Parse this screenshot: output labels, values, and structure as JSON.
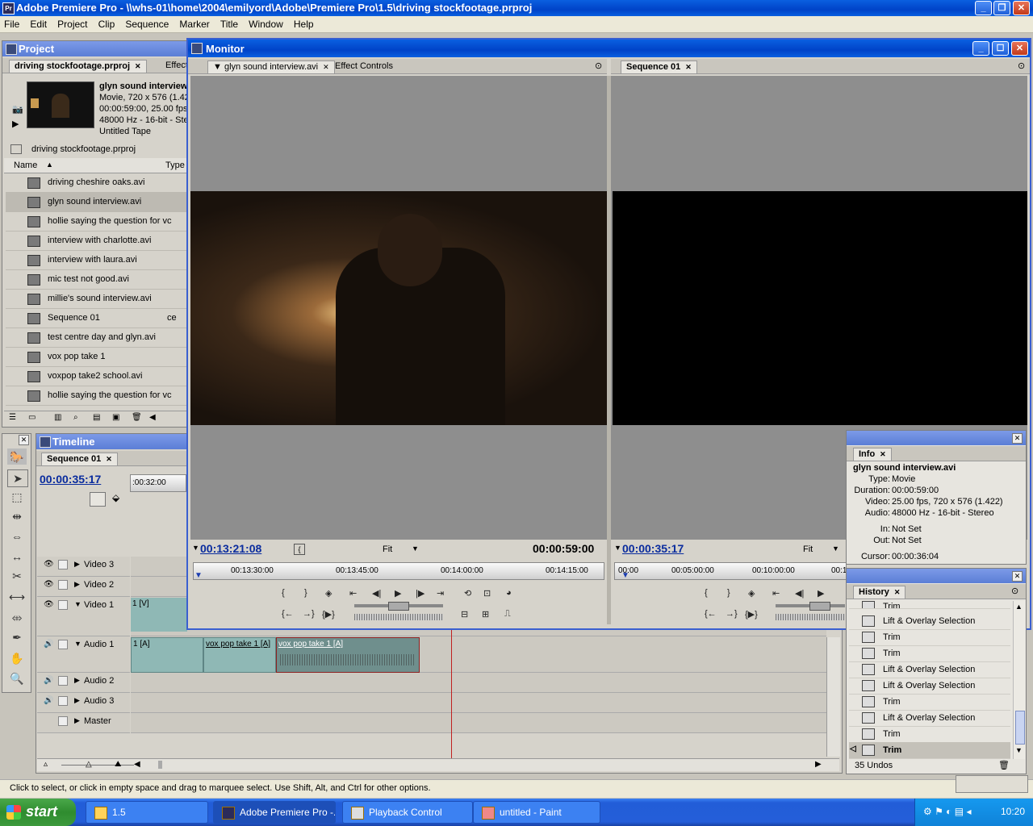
{
  "app": {
    "title": "Adobe Premiere Pro - \\\\whs-01\\home\\2004\\emilyord\\Adobe\\Premiere Pro\\1.5\\driving stockfootage.prproj"
  },
  "menu": [
    "File",
    "Edit",
    "Project",
    "Clip",
    "Sequence",
    "Marker",
    "Title",
    "Window",
    "Help"
  ],
  "project": {
    "panel_title": "Project",
    "tabs": [
      "driving stockfootage.prproj",
      "Effect"
    ],
    "preview": {
      "name": "glyn sound interview",
      "line1": "Movie, 720 x 576 (1.422",
      "line2": "00:00:59:00, 25.00 fps",
      "line3": "48000 Hz - 16-bit - Ste",
      "line4": "Untitled Tape"
    },
    "path": "driving stockfootage.prproj",
    "columns": [
      "Name",
      "Type"
    ],
    "items": [
      {
        "name": "driving cheshire oaks.avi",
        "type": ""
      },
      {
        "name": "glyn sound interview.avi",
        "type": ""
      },
      {
        "name": "hollie saying the question for vc",
        "type": ""
      },
      {
        "name": "interview with charlotte.avi",
        "type": ""
      },
      {
        "name": "interview with laura.avi",
        "type": ""
      },
      {
        "name": "mic test not good.avi",
        "type": ""
      },
      {
        "name": "millie's sound interview.avi",
        "type": ""
      },
      {
        "name": "Sequence 01",
        "type": "ce"
      },
      {
        "name": "test centre day and glyn.avi",
        "type": ""
      },
      {
        "name": "vox pop take 1",
        "type": ""
      },
      {
        "name": "voxpop take2 school.avi",
        "type": ""
      },
      {
        "name": "hollie saying the question for vc",
        "type": ""
      }
    ]
  },
  "monitor": {
    "panel_title": "Monitor",
    "source": {
      "tabs": [
        "glyn sound interview.avi",
        "Effect Controls"
      ],
      "timecode": "00:13:21:08",
      "zoom": "Fit",
      "duration": "00:00:59:00",
      "ruler": [
        "00:13:30:00",
        "00:13:45:00",
        "00:14:00:00",
        "00:14:15:00"
      ]
    },
    "program": {
      "tab": "Sequence 01",
      "timecode": "00:00:35:17",
      "zoom": "Fit",
      "ruler": [
        "00:00",
        "00:05:00:00",
        "00:10:00:00",
        "00:1"
      ]
    }
  },
  "timeline": {
    "panel_title": "Timeline",
    "tab": "Sequence 01",
    "timecode": "00:00:35:17",
    "ruler_label": ":00:32:00",
    "tracks": [
      {
        "name": "Video 3"
      },
      {
        "name": "Video 2"
      },
      {
        "name": "Video 1"
      },
      {
        "name": "Audio 1"
      },
      {
        "name": "Audio 2"
      },
      {
        "name": "Audio 3"
      },
      {
        "name": "Master"
      }
    ],
    "clips": {
      "video1": "1 [V]",
      "a1": "1 [A]",
      "a2": "vox pop take 1 [A]",
      "a3": "vox pop take 1 [A]"
    }
  },
  "info": {
    "tab": "Info",
    "title": "glyn sound interview.avi",
    "rows": [
      {
        "k": "Type:",
        "v": "Movie"
      },
      {
        "k": "Duration:",
        "v": "00:00:59:00"
      },
      {
        "k": "Video:",
        "v": "25.00 fps, 720 x 576 (1.422)"
      },
      {
        "k": "Audio:",
        "v": "48000 Hz - 16-bit - Stereo"
      },
      {
        "k": "In:",
        "v": "Not Set"
      },
      {
        "k": "Out:",
        "v": "Not Set"
      },
      {
        "k": "Cursor:",
        "v": "00:00:36:04"
      }
    ]
  },
  "history": {
    "tab": "History",
    "items": [
      "Trim",
      "Lift & Overlay Selection",
      "Trim",
      "Trim",
      "Lift & Overlay Selection",
      "Lift & Overlay Selection",
      "Trim",
      "Lift & Overlay Selection",
      "Trim",
      "Trim"
    ],
    "undos": "35 Undos"
  },
  "status": "Click to select, or click in empty space and drag to marquee select. Use Shift, Alt, and Ctrl for other options.",
  "taskbar": {
    "start": "start",
    "tasks": [
      "1.5",
      "Adobe Premiere Pro -...",
      "Playback Control",
      "untitled - Paint"
    ],
    "clock": "10:20"
  }
}
